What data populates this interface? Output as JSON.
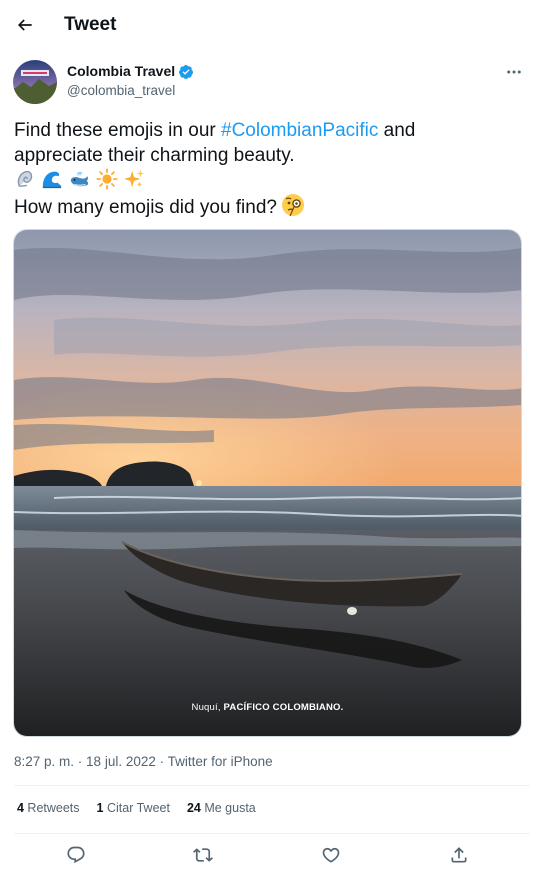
{
  "header": {
    "title": "Tweet"
  },
  "author": {
    "name": "Colombia Travel",
    "handle": "@colombia_travel"
  },
  "tweet": {
    "line1_prefix": "Find these emojis in our ",
    "hashtag": "#ColombianPacific",
    "line1_suffix": " and",
    "line2": "appreciate their charming beauty.",
    "emojis": [
      "spiral-shell",
      "water-wave",
      "spouting-whale",
      "sun",
      "sparkles"
    ],
    "line4": "How many emojis did you find?",
    "line4_emoji": "face-with-monocle"
  },
  "media": {
    "caption_place": "Nuquí, ",
    "caption_bold": "PACÍFICO COLOMBIANO."
  },
  "meta": {
    "time": "8:27 p. m.",
    "date": "18 jul. 2022",
    "source": "Twitter for iPhone",
    "separator": " · "
  },
  "stats": {
    "retweets_count": "4",
    "retweets_label": " Retweets",
    "quotes_count": "1",
    "quotes_label": " Citar Tweet",
    "likes_count": "24",
    "likes_label": " Me gusta"
  },
  "colors": {
    "accent": "#1d9bf0",
    "text_primary": "#0f1419",
    "text_secondary": "#536471",
    "divider": "#eff3f4"
  },
  "icons": {
    "back": "arrow-left-icon",
    "verified": "verified-badge-icon",
    "more": "more-horizontal-icon",
    "reply": "reply-icon",
    "retweet": "retweet-icon",
    "like": "heart-icon",
    "share": "share-icon"
  }
}
